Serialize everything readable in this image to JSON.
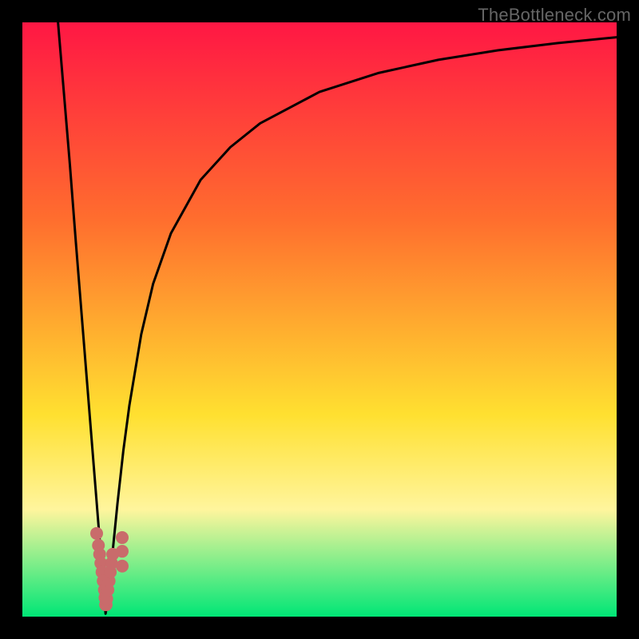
{
  "attribution": "TheBottleneck.com",
  "colors": {
    "frame": "#000000",
    "gradient_top": "#ff1744",
    "gradient_mid1": "#ff6d2e",
    "gradient_mid2": "#ffe030",
    "gradient_low": "#fff59d",
    "gradient_bottom": "#00e676",
    "curve": "#000000",
    "dots": "#c96b6b"
  },
  "chart_data": {
    "type": "line",
    "title": "",
    "xlabel": "",
    "ylabel": "",
    "xlim": [
      0,
      100
    ],
    "ylim": [
      0,
      100
    ],
    "curve": {
      "left": [
        {
          "x": 6.0,
          "y": 100.0
        },
        {
          "x": 7.0,
          "y": 88.0
        },
        {
          "x": 8.0,
          "y": 76.0
        },
        {
          "x": 9.0,
          "y": 63.0
        },
        {
          "x": 10.0,
          "y": 50.5
        },
        {
          "x": 11.0,
          "y": 38.0
        },
        {
          "x": 12.0,
          "y": 25.5
        },
        {
          "x": 13.0,
          "y": 13.0
        },
        {
          "x": 13.9,
          "y": 2.0
        },
        {
          "x": 14.0,
          "y": 0.5
        }
      ],
      "right": [
        {
          "x": 14.0,
          "y": 0.5
        },
        {
          "x": 14.4,
          "y": 3.0
        },
        {
          "x": 15.0,
          "y": 9.0
        },
        {
          "x": 16.0,
          "y": 19.0
        },
        {
          "x": 17.0,
          "y": 28.0
        },
        {
          "x": 18.0,
          "y": 35.5
        },
        {
          "x": 20.0,
          "y": 47.5
        },
        {
          "x": 22.0,
          "y": 56.0
        },
        {
          "x": 25.0,
          "y": 64.5
        },
        {
          "x": 30.0,
          "y": 73.5
        },
        {
          "x": 35.0,
          "y": 79.0
        },
        {
          "x": 40.0,
          "y": 83.0
        },
        {
          "x": 50.0,
          "y": 88.3
        },
        {
          "x": 60.0,
          "y": 91.5
        },
        {
          "x": 70.0,
          "y": 93.7
        },
        {
          "x": 80.0,
          "y": 95.3
        },
        {
          "x": 90.0,
          "y": 96.5
        },
        {
          "x": 100.0,
          "y": 97.5
        }
      ]
    },
    "dots": [
      {
        "x": 12.5,
        "y": 14.0
      },
      {
        "x": 12.8,
        "y": 12.0
      },
      {
        "x": 13.0,
        "y": 10.5
      },
      {
        "x": 13.2,
        "y": 9.0
      },
      {
        "x": 13.4,
        "y": 7.5
      },
      {
        "x": 13.6,
        "y": 6.0
      },
      {
        "x": 13.8,
        "y": 4.5
      },
      {
        "x": 13.9,
        "y": 3.2
      },
      {
        "x": 14.0,
        "y": 2.0
      },
      {
        "x": 14.1,
        "y": 2.0
      },
      {
        "x": 14.2,
        "y": 3.0
      },
      {
        "x": 14.4,
        "y": 4.5
      },
      {
        "x": 14.6,
        "y": 6.0
      },
      {
        "x": 14.8,
        "y": 7.5
      },
      {
        "x": 15.0,
        "y": 9.0
      },
      {
        "x": 15.2,
        "y": 10.5
      },
      {
        "x": 16.8,
        "y": 8.5
      },
      {
        "x": 16.8,
        "y": 11.0
      },
      {
        "x": 16.8,
        "y": 13.3
      }
    ]
  }
}
